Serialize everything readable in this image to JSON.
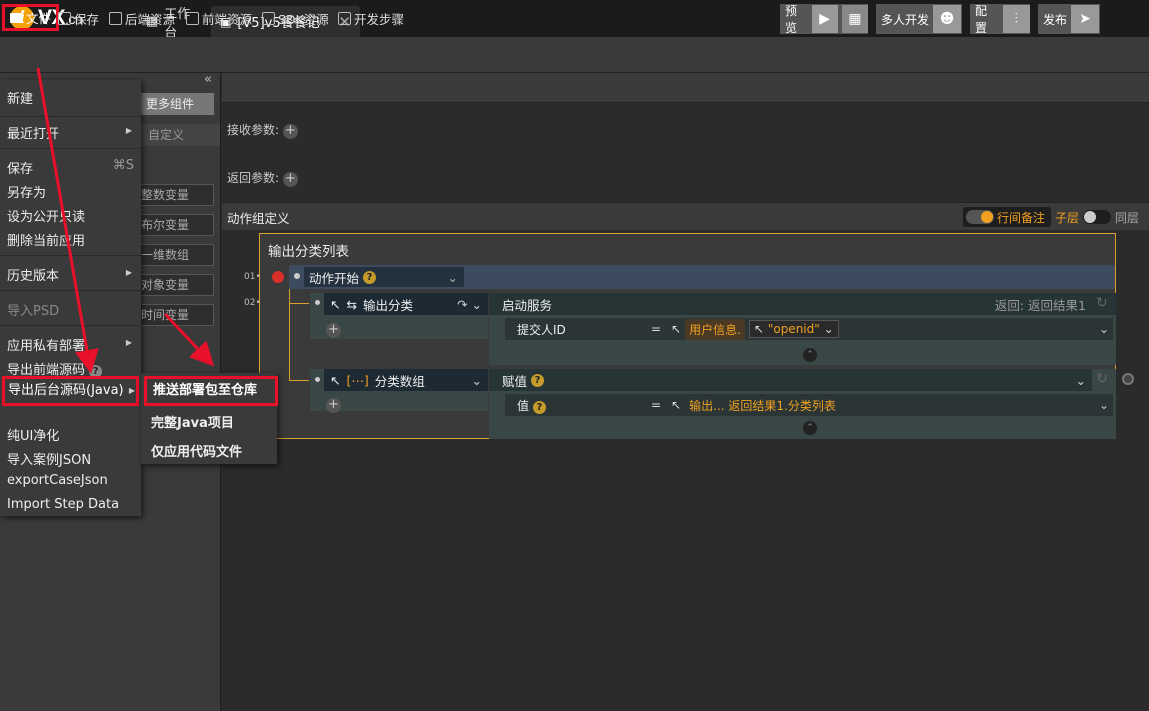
{
  "app": {
    "logo_letter": "i",
    "logo_text": "VX",
    "logo_suffix": ".cn"
  },
  "tabs": [
    {
      "label": "工作台"
    },
    {
      "label": "[V5]v5餐餐记",
      "close": "✕"
    }
  ],
  "toolbar": {
    "file": "文件",
    "save": "保存",
    "backend": "后端资源",
    "frontend": "前端资源",
    "sdk": "SDK资源",
    "steps": "开发步骤",
    "preview": "预览",
    "multi": "多人开发",
    "config": "配置",
    "publish": "发布"
  },
  "left_panel": {
    "collapse": "«",
    "more_components": "更多组件",
    "custom": "自定义",
    "vars": [
      "整数变量",
      "布尔变量",
      "一维数组",
      "对象变量",
      "时间变量"
    ]
  },
  "canvas": {
    "recv_params": "接收参数:",
    "return_params": "返回参数:",
    "section": "动作组定义",
    "line_note": "行间备注",
    "child_layer": "子层",
    "same_layer": "同层",
    "group_title": "输出分类列表",
    "line_numbers": [
      "01",
      "02"
    ],
    "action_start": "动作开始",
    "node1": {
      "label": "输出分类",
      "detail_title": "启动服务",
      "detail_right": "返回: 返回结果1",
      "field_label": "提交人ID",
      "eq": "=",
      "value1": "用户信息.",
      "value2": "\"openid\""
    },
    "node2": {
      "label": "分类数组",
      "detail_title": "赋值",
      "field_label": "值",
      "eq": "=",
      "value1": "输出... 返回结果1.分类列表"
    }
  },
  "menu": {
    "items": [
      "新建",
      "最近打开",
      "保存",
      "另存为",
      "设为公开只读",
      "删除当前应用",
      "历史版本",
      "导入PSD",
      "应用私有部署",
      "导出前端源码",
      "导出后台源码(Java)",
      "纯UI净化",
      "导入案例JSON",
      "exportCaseJson",
      "Import Step Data"
    ],
    "save_shortcut": "⌘S",
    "submenu": [
      "推送部署包至仓库",
      "完整Java项目",
      "仅应用代码文件"
    ]
  },
  "colors": {
    "accent": "#f0a020",
    "highlight": "#e8102a",
    "bg": "#2b2b2b"
  }
}
